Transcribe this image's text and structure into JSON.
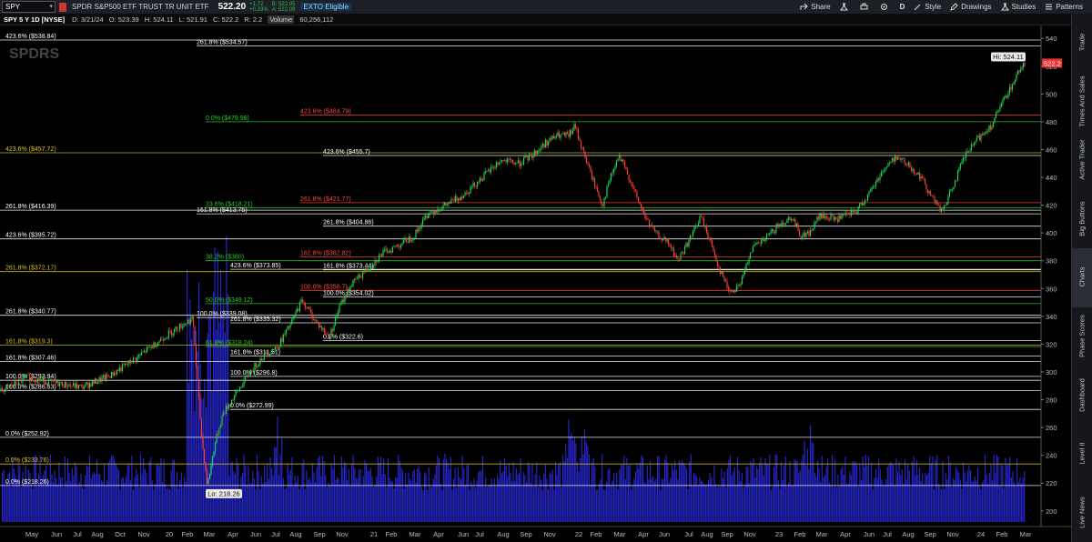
{
  "toolbar": {
    "symbol": "SPY",
    "description": "SPDR S&P500 ETF TRUST TR UNIT ETF",
    "last": "522.20",
    "change": "+1.72",
    "change_pct": "+0.33%",
    "bid": "B: 522.05",
    "ask": "A: 522.09",
    "exto": "EXTO Eligible",
    "share": "Share",
    "period": "D",
    "style": "Style",
    "drawings": "Drawings",
    "studies": "Studies",
    "patterns": "Patterns"
  },
  "quote": {
    "title": "SPY 5 Y 1D [NYSE]",
    "date": "D: 3/21/24",
    "open": "O: 523.39",
    "high": "H: 524.11",
    "low": "L: 521.91",
    "close": "C: 522.2",
    "range": "R: 2.2",
    "volume_label": "Volume",
    "volume": "60,256,112"
  },
  "side_tabs": [
    "Trade",
    "Times And Sales",
    "Active Trader",
    "Big Buttons",
    "Charts",
    "Phase Scores",
    "Dashboard",
    "Level II",
    "Live News"
  ],
  "colors": {
    "up": "#1fd655",
    "down": "#ff3b3b",
    "volume": "#2727d6",
    "white_fib": "#ffffff",
    "yellow_fib": "#d9c21e",
    "green_fib": "#28d028",
    "red_fib": "#ff4444"
  },
  "chart_data": {
    "type": "candlestick",
    "ylim": [
      192,
      548
    ],
    "y_ticks": [
      200,
      220,
      240,
      260,
      280,
      300,
      320,
      340,
      360,
      380,
      400,
      420,
      440,
      460,
      480,
      500,
      520,
      540
    ],
    "x_labels": [
      "May",
      "Jun",
      "Jul",
      "Aug",
      "Oct",
      "Nov",
      "20",
      "Feb",
      "Mar",
      "Apr",
      "Jun",
      "Jul",
      "Aug",
      "Sep",
      "Nov",
      "21",
      "Feb",
      "Mar",
      "Apr",
      "Jun",
      "Jul",
      "Aug",
      "Sep",
      "Nov",
      "22",
      "Feb",
      "Mar",
      "Apr",
      "Jun",
      "Jul",
      "Aug",
      "Sep",
      "Nov",
      "23",
      "Feb",
      "Mar",
      "Apr",
      "Jun",
      "Jul",
      "Aug",
      "Sep",
      "Nov",
      "24",
      "Feb",
      "Mar"
    ],
    "last_price_badge": "522.2",
    "hi_label": "Hi: 524.11",
    "lo_label": "Lo: 218.26",
    "watermark": "SPDRS",
    "price_path": [
      [
        0,
        286
      ],
      [
        30,
        296
      ],
      [
        60,
        292
      ],
      [
        90,
        289
      ],
      [
        120,
        297
      ],
      [
        150,
        310
      ],
      [
        180,
        325
      ],
      [
        205,
        336
      ],
      [
        212,
        338
      ],
      [
        216,
        300
      ],
      [
        222,
        250
      ],
      [
        228,
        218
      ],
      [
        236,
        248
      ],
      [
        245,
        270
      ],
      [
        260,
        285
      ],
      [
        275,
        300
      ],
      [
        290,
        312
      ],
      [
        305,
        318
      ],
      [
        320,
        335
      ],
      [
        332,
        352
      ],
      [
        345,
        338
      ],
      [
        355,
        330
      ],
      [
        362,
        325
      ],
      [
        372,
        345
      ],
      [
        385,
        362
      ],
      [
        400,
        372
      ],
      [
        420,
        385
      ],
      [
        440,
        392
      ],
      [
        455,
        398
      ],
      [
        470,
        414
      ],
      [
        490,
        420
      ],
      [
        510,
        428
      ],
      [
        530,
        440
      ],
      [
        550,
        452
      ],
      [
        570,
        450
      ],
      [
        585,
        456
      ],
      [
        600,
        465
      ],
      [
        612,
        470
      ],
      [
        625,
        470
      ],
      [
        632,
        477
      ],
      [
        640,
        460
      ],
      [
        648,
        445
      ],
      [
        655,
        432
      ],
      [
        662,
        420
      ],
      [
        670,
        438
      ],
      [
        680,
        455
      ],
      [
        690,
        442
      ],
      [
        700,
        425
      ],
      [
        710,
        410
      ],
      [
        720,
        400
      ],
      [
        735,
        392
      ],
      [
        745,
        380
      ],
      [
        760,
        398
      ],
      [
        770,
        412
      ],
      [
        780,
        395
      ],
      [
        790,
        375
      ],
      [
        800,
        360
      ],
      [
        805,
        358
      ],
      [
        815,
        365
      ],
      [
        825,
        388
      ],
      [
        840,
        395
      ],
      [
        855,
        405
      ],
      [
        870,
        412
      ],
      [
        880,
        398
      ],
      [
        890,
        400
      ],
      [
        900,
        412
      ],
      [
        920,
        410
      ],
      [
        940,
        415
      ],
      [
        955,
        428
      ],
      [
        970,
        445
      ],
      [
        985,
        455
      ],
      [
        1000,
        448
      ],
      [
        1012,
        440
      ],
      [
        1025,
        425
      ],
      [
        1035,
        415
      ],
      [
        1045,
        430
      ],
      [
        1060,
        455
      ],
      [
        1075,
        468
      ],
      [
        1090,
        478
      ],
      [
        1105,
        498
      ],
      [
        1115,
        510
      ],
      [
        1122,
        520
      ],
      [
        1126,
        522.2
      ]
    ],
    "volume_note": "daily volume bars along bottom",
    "fib_lines": [
      {
        "label": "423.6% ($538.84)",
        "value": 538.84,
        "color": "white",
        "side": "left"
      },
      {
        "label": "261.8% ($534.57)",
        "value": 534.57,
        "color": "white",
        "side": "mid"
      },
      {
        "label": "423.6% ($484.79)",
        "value": 484.79,
        "color": "red",
        "side": "mid"
      },
      {
        "label": "0.0% ($479.98)",
        "value": 479.98,
        "color": "green",
        "side": "mid"
      },
      {
        "label": "423.6% ($457.72)",
        "value": 457.72,
        "color": "yellow",
        "side": "left"
      },
      {
        "label": "423.6% ($455.7)",
        "value": 455.7,
        "color": "white",
        "side": "mid"
      },
      {
        "label": "261.8% ($421.77)",
        "value": 421.77,
        "color": "red",
        "side": "mid"
      },
      {
        "label": "23.6% ($418.21)",
        "value": 418.21,
        "color": "green",
        "side": "mid"
      },
      {
        "label": "261.8% ($416.39)",
        "value": 416.39,
        "color": "white",
        "side": "left"
      },
      {
        "label": "161.8% ($413.75)",
        "value": 413.75,
        "color": "white",
        "side": "mid"
      },
      {
        "label": "261.8% ($404.86)",
        "value": 404.86,
        "color": "white",
        "side": "mid"
      },
      {
        "label": "423.6% ($395.72)",
        "value": 395.72,
        "color": "white",
        "side": "left"
      },
      {
        "label": "161.8% ($382.82)",
        "value": 382.82,
        "color": "red",
        "side": "mid"
      },
      {
        "label": "38.2% ($380)",
        "value": 380,
        "color": "green",
        "side": "mid"
      },
      {
        "label": "423.6% ($373.85)",
        "value": 373.85,
        "color": "white",
        "side": "mid"
      },
      {
        "label": "161.8% ($373.44)",
        "value": 373.44,
        "color": "white",
        "side": "mid"
      },
      {
        "label": "261.8% ($372.17)",
        "value": 372.17,
        "color": "yellow",
        "side": "left"
      },
      {
        "label": "100.0% ($358.7)",
        "value": 358.7,
        "color": "red",
        "side": "mid"
      },
      {
        "label": "100.0% ($354.02)",
        "value": 354.02,
        "color": "white",
        "side": "mid"
      },
      {
        "label": "50.0% ($349.12)",
        "value": 349.12,
        "color": "green",
        "side": "mid"
      },
      {
        "label": "261.8% ($340.77)",
        "value": 340.77,
        "color": "white",
        "side": "left"
      },
      {
        "label": "100.0% ($339.08)",
        "value": 339.08,
        "color": "white",
        "side": "mid"
      },
      {
        "label": "261.8% ($335.32)",
        "value": 335.32,
        "color": "white",
        "side": "mid"
      },
      {
        "label": "0.0% ($322.6)",
        "value": 322.6,
        "color": "white",
        "side": "mid"
      },
      {
        "label": "161.8% ($319.3)",
        "value": 319.3,
        "color": "yellow",
        "side": "left"
      },
      {
        "label": "61.8% ($318.24)",
        "value": 318.24,
        "color": "green",
        "side": "mid"
      },
      {
        "label": "161.8% ($311.51)",
        "value": 311.51,
        "color": "white",
        "side": "mid"
      },
      {
        "label": "161.8% ($307.46)",
        "value": 307.46,
        "color": "white",
        "side": "left"
      },
      {
        "label": "100.0% ($296.8)",
        "value": 296.8,
        "color": "white",
        "side": "mid"
      },
      {
        "label": "100.0% ($293.94)",
        "value": 293.94,
        "color": "white",
        "side": "left"
      },
      {
        "label": "100.0% ($286.63)",
        "value": 286.63,
        "color": "white",
        "side": "left"
      },
      {
        "label": "0.0% ($272.99)",
        "value": 272.99,
        "color": "white",
        "side": "mid"
      },
      {
        "label": "0.0% ($252.92)",
        "value": 252.92,
        "color": "white",
        "side": "left"
      },
      {
        "label": "0.0% ($233.76)",
        "value": 233.76,
        "color": "yellow",
        "side": "left"
      },
      {
        "label": "0.0% ($218.26)",
        "value": 218.26,
        "color": "white",
        "side": "left"
      }
    ]
  }
}
